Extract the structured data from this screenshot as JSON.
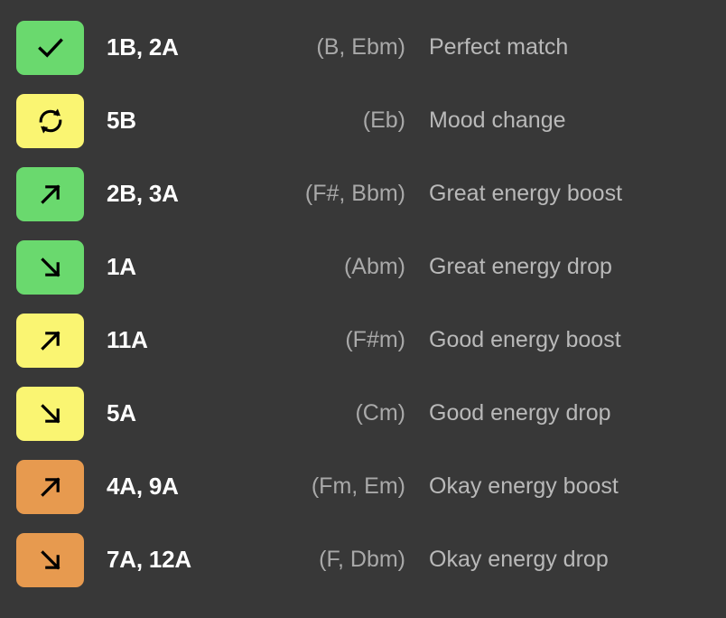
{
  "background_color": "#383838",
  "colors": {
    "green": "#6ad96e",
    "yellow": "#faf572",
    "orange": "#e79a4f",
    "key_text": "#ffffff",
    "note_text": "#a9a9a9",
    "desc_text": "#b9b9b9",
    "icon": "#000000"
  },
  "legend": {
    "rows": [
      {
        "icon": "check-icon",
        "swatch_color": "#6ad96e",
        "keys": "1B, 2A",
        "notes": "(B, Ebm)",
        "description": "Perfect match"
      },
      {
        "icon": "refresh-icon",
        "swatch_color": "#faf572",
        "keys": "5B",
        "notes": "(Eb)",
        "description": "Mood change"
      },
      {
        "icon": "arrow-up-right-icon",
        "swatch_color": "#6ad96e",
        "keys": "2B, 3A",
        "notes": "(F#, Bbm)",
        "description": "Great energy boost"
      },
      {
        "icon": "arrow-down-right-icon",
        "swatch_color": "#6ad96e",
        "keys": "1A",
        "notes": "(Abm)",
        "description": "Great energy drop"
      },
      {
        "icon": "arrow-up-right-icon",
        "swatch_color": "#faf572",
        "keys": "11A",
        "notes": "(F#m)",
        "description": "Good energy boost"
      },
      {
        "icon": "arrow-down-right-icon",
        "swatch_color": "#faf572",
        "keys": "5A",
        "notes": "(Cm)",
        "description": "Good energy drop"
      },
      {
        "icon": "arrow-up-right-icon",
        "swatch_color": "#e79a4f",
        "keys": "4A, 9A",
        "notes": "(Fm, Em)",
        "description": "Okay energy boost"
      },
      {
        "icon": "arrow-down-right-icon",
        "swatch_color": "#e79a4f",
        "keys": "7A, 12A",
        "notes": "(F, Dbm)",
        "description": "Okay energy drop"
      }
    ]
  }
}
